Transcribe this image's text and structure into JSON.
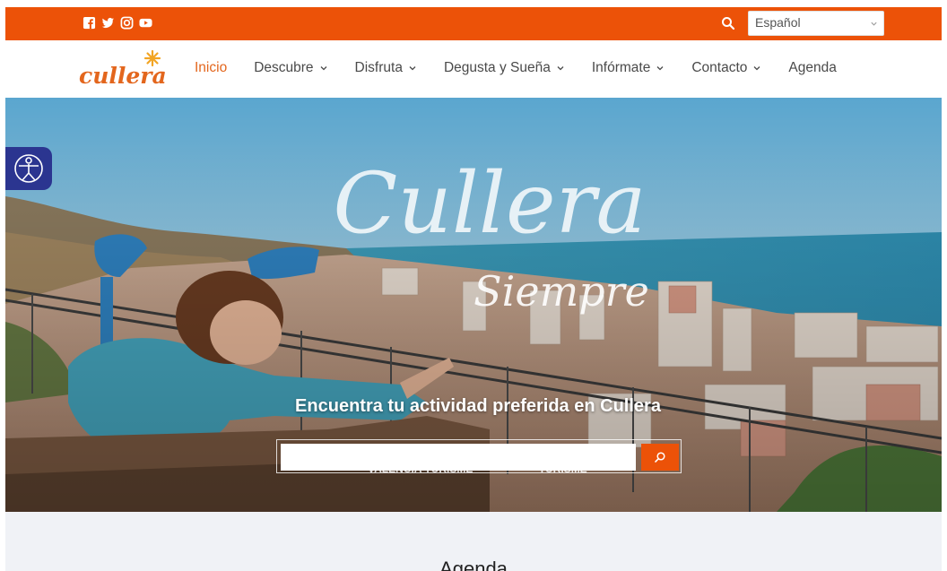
{
  "topbar": {
    "bg_color": "#ec5208",
    "social_icons": [
      "facebook-icon",
      "twitter-icon",
      "instagram-icon",
      "youtube-icon"
    ],
    "language": {
      "selected": "Español"
    }
  },
  "nav": {
    "logo_text": "cullera",
    "items": [
      {
        "label": "Inicio",
        "active": true,
        "dropdown": false
      },
      {
        "label": "Descubre",
        "active": false,
        "dropdown": true
      },
      {
        "label": "Disfruta",
        "active": false,
        "dropdown": true
      },
      {
        "label": "Degusta y Sueña",
        "active": false,
        "dropdown": true
      },
      {
        "label": "Infórmate",
        "active": false,
        "dropdown": true
      },
      {
        "label": "Contacto",
        "active": false,
        "dropdown": true
      },
      {
        "label": "Agenda",
        "active": false,
        "dropdown": false
      }
    ],
    "active_color": "#e3661d"
  },
  "hero": {
    "script_title": "Cullera",
    "script_subtitle": "Siempre",
    "heading": "Encuentra tu actividad preferida en Cullera",
    "search": {
      "value": "",
      "placeholder": ""
    },
    "partners": [
      "VALENCIA TURISME",
      "TURISME"
    ]
  },
  "sections": {
    "agenda_title": "Agenda"
  }
}
